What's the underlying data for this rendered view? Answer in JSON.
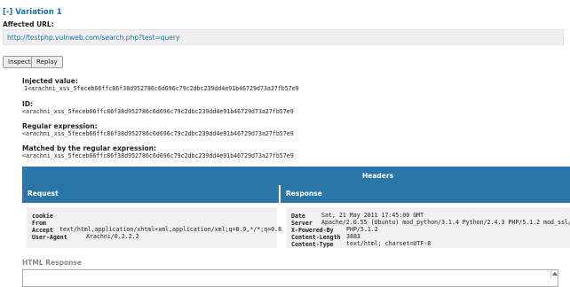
{
  "variation": {
    "title": "[-] Variation 1"
  },
  "affected_url": {
    "label": "Affected URL:",
    "url": "http://testphp.vulnweb.com/search.php?test=query"
  },
  "buttons": {
    "inspect": "Inspect",
    "replay": "Replay"
  },
  "fields": {
    "injected_value_label": "Injected value:",
    "injected_value": "1<arachni_xss_5feceb66ffc86f38d952786c6d696c79c2dbc239dd4e91b46729d73a27fb57e9",
    "id_label": "ID:",
    "id_value": "<arachni_xss_5feceb66ffc86f38d952786c6d696c79c2dbc239dd4e91b46729d73a27fb57e9",
    "regex_label": "Regular expression:",
    "regex_value": "<arachni_xss_5feceb66ffc86f38d952786c6d696c79c2dbc239dd4e91b46729d73a27fb57e9",
    "matched_label": "Matched by the regular expression:",
    "matched_value": "<arachni_xss_5feceb66ffc86f38d952786c6d696c79c2dbc239dd4e91b46729d73a27fb57e9"
  },
  "headers": {
    "title": "Headers",
    "request_title": "Request",
    "response_title": "Response",
    "request": [
      {
        "key": "cookie",
        "value": ""
      },
      {
        "key": "From",
        "value": ""
      },
      {
        "key": "Accept",
        "value": "text/html,application/xhtml+xml,application/xml;q=0.9,*/*;q=0.8"
      },
      {
        "key": "User-Agent",
        "value": "Arachni/0.2.2.2"
      }
    ],
    "response": [
      {
        "key": "Date",
        "value": "Sat, 21 May 2011 17:45:00 GMT"
      },
      {
        "key": "Server",
        "value": "Apache/2.0.55 (Ubuntu) mod_python/3.1.4 Python/2.4.3 PHP/5.1.2 mod_ssl/2.0."
      },
      {
        "key": "X-Powered-By",
        "value": "PHP/5.1.2"
      },
      {
        "key": "Content-Length",
        "value": "3883"
      },
      {
        "key": "Content-Type",
        "value": "text/html; charset=UTF-8"
      }
    ]
  },
  "html_response": {
    "title": "HTML Response"
  },
  "colors": {
    "accent": "#2a76a8",
    "link": "#1e6fa3"
  }
}
